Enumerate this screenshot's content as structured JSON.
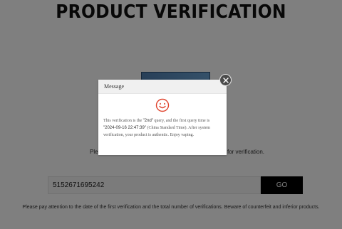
{
  "page": {
    "title": "PRODUCT VERIFICATION",
    "instruction_left": "Plea",
    "instruction_right": "for verification.",
    "search": {
      "value": "5152671695242",
      "placeholder": ""
    },
    "go_label": "GO",
    "footer_note": "Please pay attention to the date of the first verification and the total number of verifications. Beware of counterfeit and inferior products."
  },
  "modal": {
    "title": "Message",
    "close_icon": "close-icon",
    "status_icon": "smile-icon",
    "status_color": "#e0452f",
    "body": {
      "part1": "This verification is the ",
      "query_count": "\"2nd\"",
      "part2": " query, and the first query time is ",
      "first_time": "\"2024-09-16 22:47:39\"",
      "part3": " (China Standard Time). After system verification, your product is authentic. Enjoy vaping."
    }
  },
  "colors": {
    "overlay": "#000000",
    "go_button": "#000000",
    "go_text": "#ffffff",
    "modal_header": "#f0f0f0"
  }
}
